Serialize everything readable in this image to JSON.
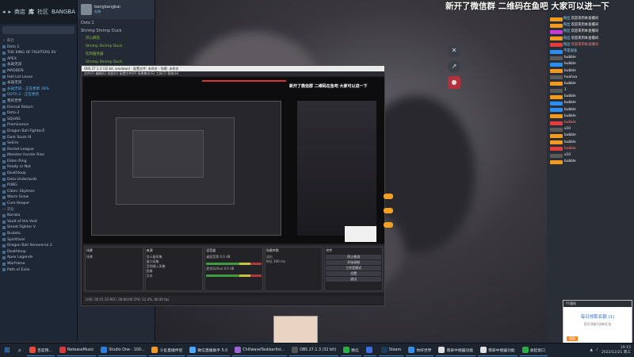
{
  "banner": "新开了微信群 二维码在鱼吧 大家可以进一下",
  "banner_small": "新开了微信群  二维码在鱼吧  大家可以进一下",
  "steam": {
    "tabs": [
      "商店",
      "库",
      "社区",
      "BANGBA"
    ],
    "items": [
      "— 最近",
      "Dota 2",
      "THE KING OF FIGHTERS XV",
      "APEX",
      "永劫无间",
      "MADDEN",
      "Hell Let Loose",
      "永劫无间",
      "永劫无间 - 正在更新 38%",
      "DOTA 2 - 正在更新",
      "我的世界",
      "Eternal Return",
      "Dota 2",
      "SQUAD",
      "Prominence",
      "Dragon Ball FighterZ",
      "Dark Souls III",
      "Sekiro",
      "Rocket League",
      "Monster Hunter Rise",
      "Elden Ring",
      "Ready or Not",
      "Deathloop",
      "Dota Underlords",
      "PUBG",
      "Cities: Skylines",
      "Warm Snow",
      "Core Keeper",
      "— 其他",
      "Naraka",
      "Vault of the Void",
      "Street Fighter V",
      "Brotato",
      "Spiritfarer",
      "Dragon Ball Xenoverse 2",
      "Deathloop",
      "Apex Legends",
      "Warframe",
      "Path of Exile"
    ]
  },
  "friends": {
    "user": "bangbangbai",
    "status": "在线",
    "groups": [
      {
        "label": "Dota 2",
        "sub": false
      },
      {
        "label": "Shrimp Shrimp Duck",
        "sub": false
      },
      {
        "label": "开心麻花",
        "sub": true
      },
      {
        "label": "Shrimp Shrimp Duck",
        "sub": true
      },
      {
        "label": "吃鸡服务器",
        "sub": true
      },
      {
        "label": "Shrimp Shrimp Duck",
        "sub": true
      }
    ]
  },
  "obs": {
    "title": "OBS 27.1.3 (32 bit, windows) - 配置文件: 未命名 - 场景: 未命名",
    "menu": "文件(F)  编辑(E)  视图(V)  配置文件(P)  场景集合(S)  工具(T)  帮助(H)",
    "docks": [
      {
        "head": "场景",
        "lines": [
          "场景"
        ]
      },
      {
        "head": "来源",
        "lines": [
          "显示器采集",
          "窗口采集",
          "音频输入采集",
          "图像",
          "文本"
        ]
      },
      {
        "head": "混音器",
        "lines": [
          "桌面音频  0.0 dB",
          "麦克风/Aux  0.0 dB"
        ]
      },
      {
        "head": "场景转换",
        "lines": [
          "淡出",
          "时长 300 ms"
        ]
      },
      {
        "head": "控件",
        "buttons": [
          "停止推流",
          "开始录制",
          "工作室模式",
          "设置",
          "退出"
        ]
      }
    ],
    "status": "LIVE: 00:51:33   REC: 00:00:00   CPU: 12.4%, 60.00 fps"
  },
  "chat": [
    {
      "user": "粉丝",
      "text": "欢迎来到本直播间",
      "color": "#f39a1e"
    },
    {
      "user": "粉丝",
      "text": "欢迎来到本直播间",
      "color": "#f39a1e"
    },
    {
      "user": "粉丝",
      "text": "欢迎来到本直播间",
      "color": "#c63bd6"
    },
    {
      "user": "粉丝",
      "text": "欢迎来到本直播间",
      "color": "#f39a1e"
    },
    {
      "user": "粉丝",
      "text": "欢迎来到本直播间",
      "color": "#e43b3b"
    },
    {
      "user": "不是很会",
      "text": "",
      "color": "#2c8ef0"
    },
    {
      "user": "",
      "text": "bubble",
      "color": "#5a5a5a"
    },
    {
      "user": "",
      "text": "bubble",
      "color": "#2c8ef0"
    },
    {
      "user": "",
      "text": "bubble",
      "color": "#f39a1e"
    },
    {
      "user": "",
      "text": "huahua",
      "color": "#5a5a5a"
    },
    {
      "user": "",
      "text": "bubble",
      "color": "#f39a1e"
    },
    {
      "user": "",
      "text": "1",
      "color": "#5a5a5a"
    },
    {
      "user": "",
      "text": "bubble",
      "color": "#f39a1e"
    },
    {
      "user": "",
      "text": "bubble",
      "color": "#2c8ef0"
    },
    {
      "user": "",
      "text": "bubble",
      "color": "#2c8ef0"
    },
    {
      "user": "",
      "text": "bubble",
      "color": "#f39a1e"
    },
    {
      "user": "",
      "text": "bubble",
      "color": "#e43b3b"
    },
    {
      "user": "",
      "text": "x10",
      "color": "#5a5a5a"
    },
    {
      "user": "",
      "text": "bubble",
      "color": "#f39a1e"
    },
    {
      "user": "",
      "text": "bubble",
      "color": "#f39a1e"
    },
    {
      "user": "",
      "text": "bubble",
      "color": "#e43b3b"
    },
    {
      "user": "",
      "text": "x10",
      "color": "#5a5a5a"
    },
    {
      "user": "",
      "text": "bubble",
      "color": "#f39a1e"
    }
  ],
  "notify": {
    "head": "YY通知",
    "title": "每日领取名额 (1)",
    "desc": "您可领取1份新礼包",
    "button": "领取"
  },
  "taskbar": {
    "apps": [
      {
        "label": "百度网...",
        "color": "#e34b3b"
      },
      {
        "label": "NeteaseMusic",
        "color": "#d63a3a"
      },
      {
        "label": "Studio One - 100...",
        "color": "#2d7ee0"
      },
      {
        "label": "斗鱼直播伴侣",
        "color": "#f39a1e"
      },
      {
        "label": "微信直播助手 5.0",
        "color": "#4aa8ff"
      },
      {
        "label": "ChillwaveTaskbarlist...",
        "color": "#9e62d6"
      },
      {
        "label": "OBS 27.1.3 (32 bit)",
        "color": "#555"
      },
      {
        "label": "微信",
        "color": "#2aae45"
      },
      {
        "label": "",
        "color": "#3b6fe3"
      },
      {
        "label": "Steam",
        "color": "#1f3b5a"
      },
      {
        "label": "你好世界",
        "color": "#3a8de4"
      },
      {
        "label": "翡翠中继器功能",
        "color": "#e0e0e0"
      },
      {
        "label": "翡翠中继器功能",
        "color": "#e0e0e0"
      },
      {
        "label": "收起窗口",
        "color": "#2aae45"
      }
    ],
    "time": "19:15",
    "date": "2022/12/21 周三"
  }
}
